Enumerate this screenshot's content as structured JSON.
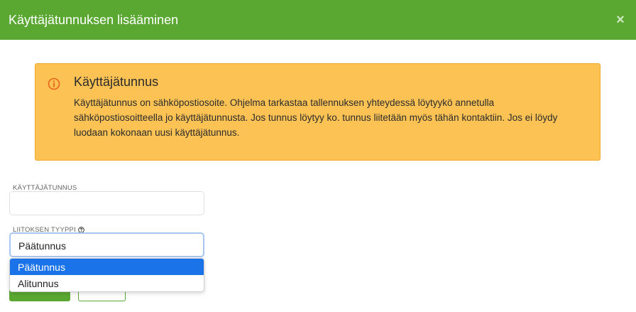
{
  "modal": {
    "title": "Käyttäjätunnuksen lisääminen",
    "close_icon": "×"
  },
  "alert": {
    "title": "Käyttäjätunnus",
    "body": "Käyttäjätunnus on sähköpostiosoite. Ohjelma tarkastaa tallennuksen yhteydessä löytyykö annetulla sähköpostiosoitteella jo käyttäjätunnusta. Jos tunnus löytyy ko. tunnus liitetään myös tähän kontaktiin. Jos ei löydy luodaan kokonaan uusi käyttäjätunnus.",
    "icon": "info-circle-icon"
  },
  "form": {
    "username_label": "KÄYTTÄJÄTUNNUS",
    "username_value": "",
    "link_type_label": "LIITOKSEN TYYPPI",
    "link_type_value": "Päätunnus",
    "options": [
      "Päätunnus",
      "Alitunnus"
    ]
  },
  "colors": {
    "header": "#5aa832",
    "alert_bg": "#fcc254",
    "option_selected": "#1a73e8"
  }
}
